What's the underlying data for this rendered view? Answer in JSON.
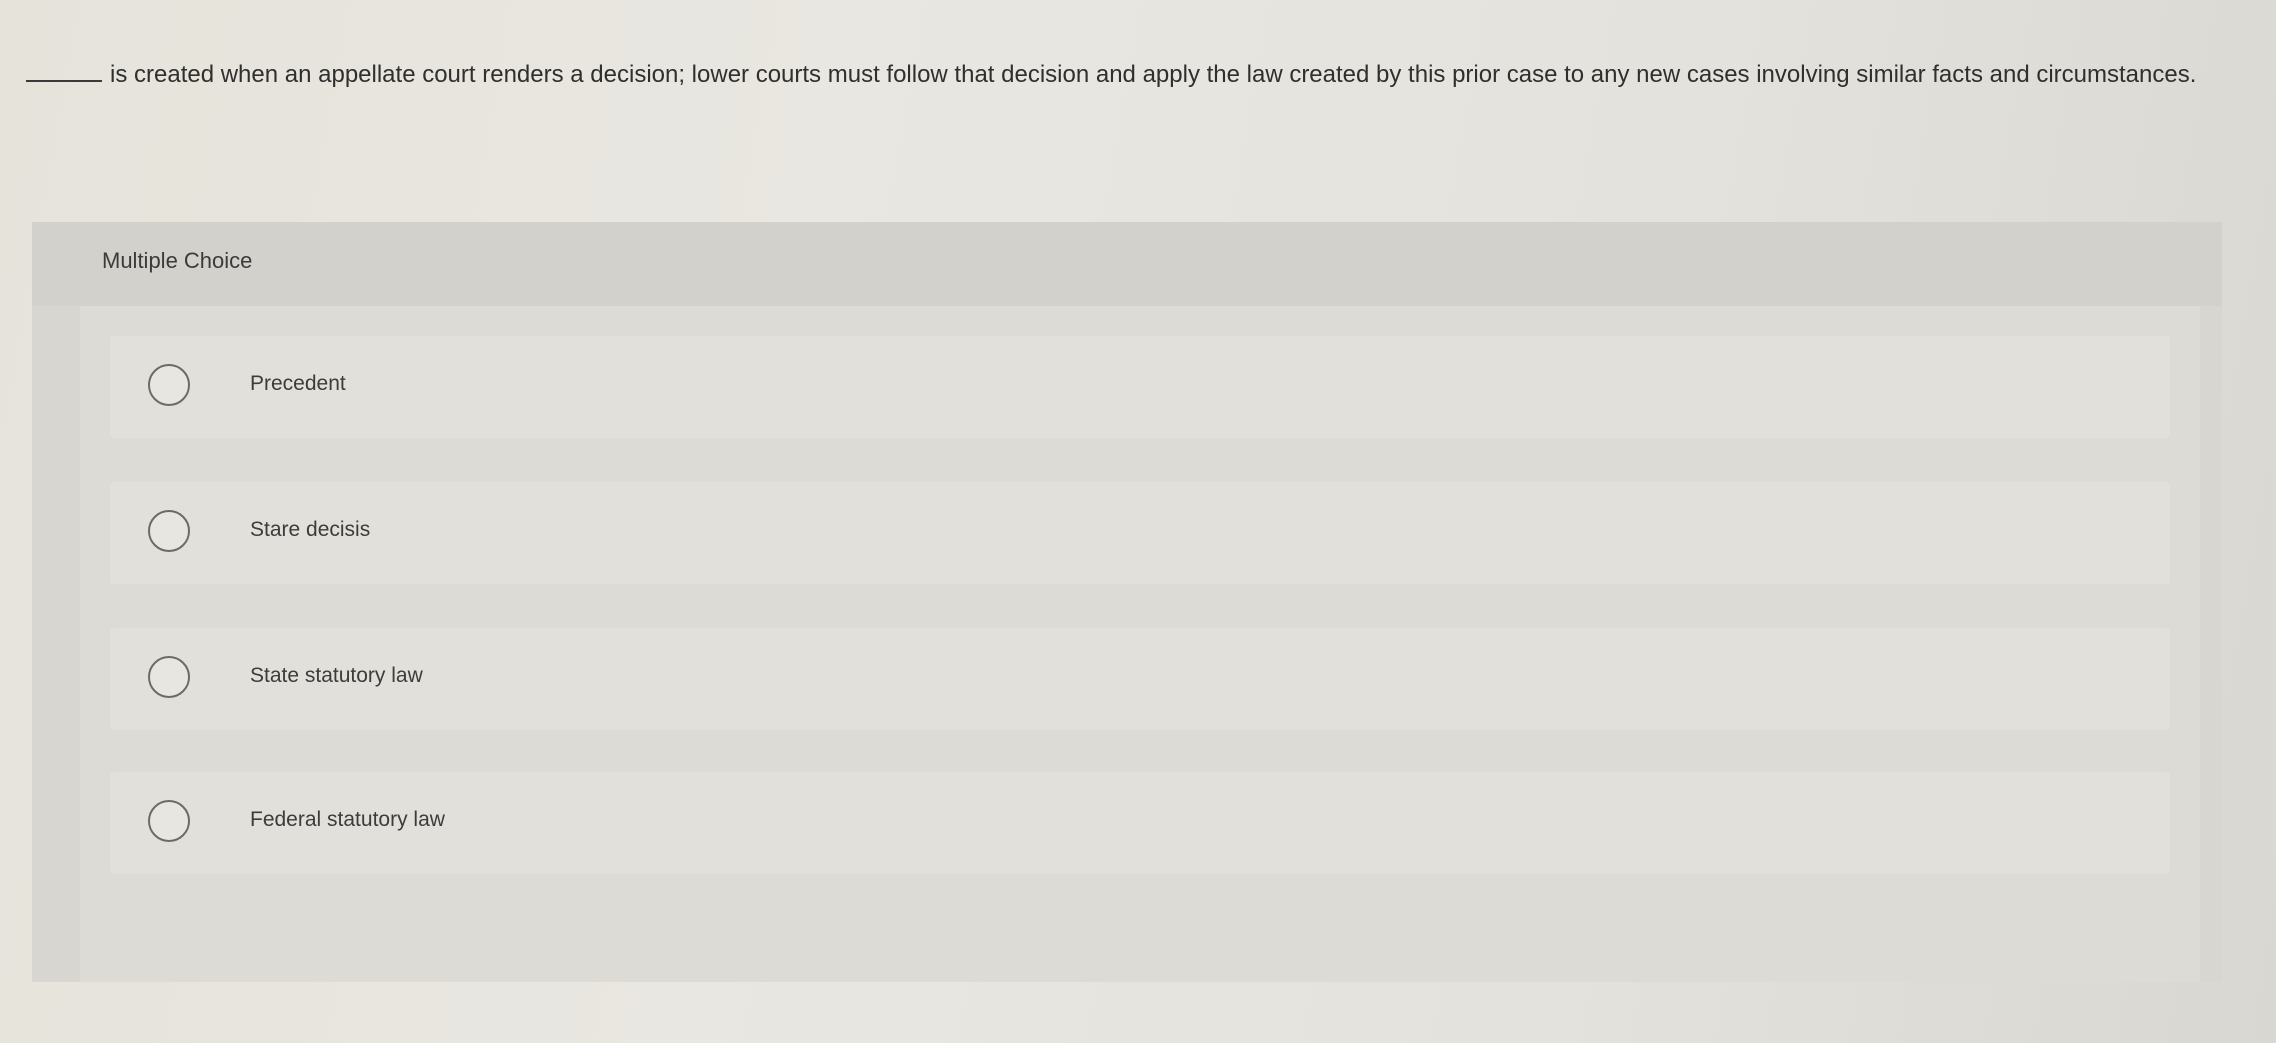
{
  "question": {
    "text": "is created when an appellate court renders a decision; lower courts must follow that decision and apply the law created by this prior case to any new cases involving similar facts and circumstances."
  },
  "multiple_choice": {
    "header": "Multiple Choice",
    "options": [
      {
        "label": "Precedent"
      },
      {
        "label": "Stare decisis"
      },
      {
        "label": "State statutory law"
      },
      {
        "label": "Federal statutory law"
      }
    ]
  }
}
